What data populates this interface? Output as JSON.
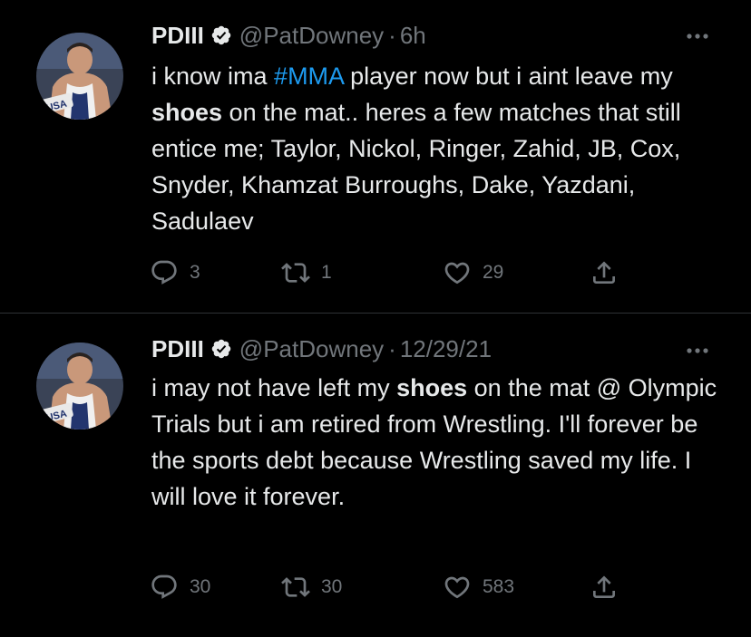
{
  "tweets": [
    {
      "display_name": "PDIII",
      "handle": "@PatDowney",
      "separator": "·",
      "time": "6h",
      "text_parts": {
        "p1": "i know ima ",
        "hashtag": "#MMA",
        "p2": " player now but i aint leave my ",
        "bold": "shoes",
        "p3": " on the mat.. heres a few matches that still entice me; Taylor, Nickol, Ringer, Zahid, JB, Cox, Snyder, Khamzat Burroughs, Dake, Yazdani, Sadulaev"
      },
      "replies": "3",
      "retweets": "1",
      "likes": "29",
      "avatar_text": "USA"
    },
    {
      "display_name": "PDIII",
      "handle": "@PatDowney",
      "separator": "·",
      "time": "12/29/21",
      "text_parts": {
        "p1": "i may not have left my ",
        "bold": "shoes",
        "p2": " on the mat @ Olympic Trials but i am retired from Wrestling. I'll forever be the sports debt because Wrestling saved my life. I will love it forever."
      },
      "replies": "30",
      "retweets": "30",
      "likes": "583",
      "avatar_text": "USA"
    }
  ],
  "icons": {
    "verified": "verified-badge-icon",
    "more": "more-options-icon",
    "reply": "reply-icon",
    "retweet": "retweet-icon",
    "like": "like-icon",
    "share": "share-icon"
  },
  "colors": {
    "background": "#000000",
    "text": "#e7e9ea",
    "secondary": "#71767b",
    "accent": "#1d9bf0",
    "divider": "#2f3336"
  }
}
